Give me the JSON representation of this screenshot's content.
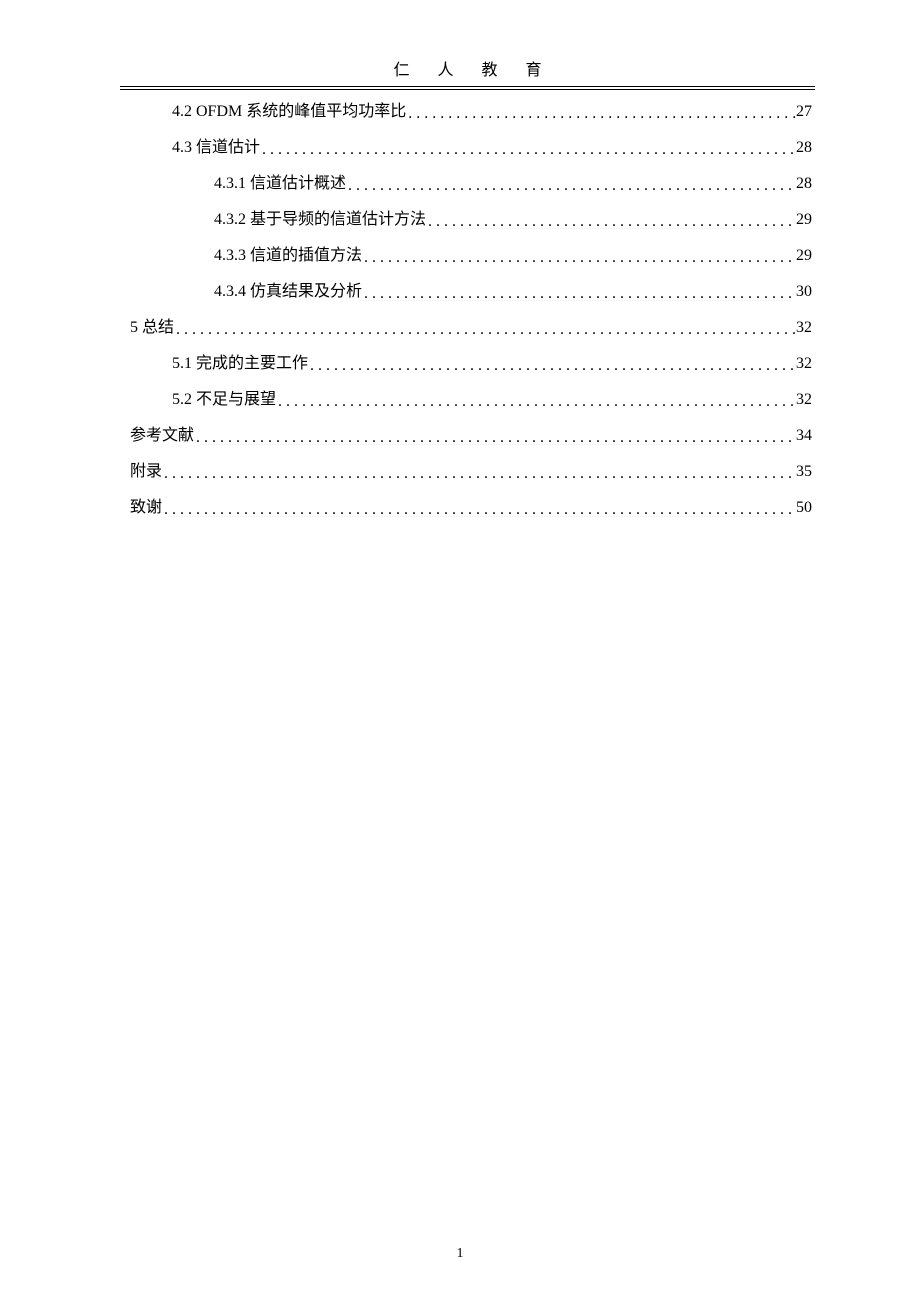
{
  "header": {
    "title": "仁 人 教 育"
  },
  "toc": [
    {
      "indent": 1,
      "label": "4.2 OFDM 系统的峰值平均功率比",
      "page": "27"
    },
    {
      "indent": 1,
      "label": "4.3 信道估计",
      "page": "28"
    },
    {
      "indent": 2,
      "label": "4.3.1 信道估计概述",
      "page": "28"
    },
    {
      "indent": 2,
      "label": "4.3.2 基于导频的信道估计方法",
      "page": "29"
    },
    {
      "indent": 2,
      "label": "4.3.3 信道的插值方法",
      "page": "29"
    },
    {
      "indent": 2,
      "label": "4.3.4 仿真结果及分析",
      "page": "30"
    },
    {
      "indent": 0,
      "label": "5 总结",
      "page": "32"
    },
    {
      "indent": 1,
      "label": "5.1 完成的主要工作",
      "page": "32"
    },
    {
      "indent": 1,
      "label": "5.2 不足与展望",
      "page": "32"
    },
    {
      "indent": 0,
      "label": "参考文献",
      "page": "34"
    },
    {
      "indent": 0,
      "label": "附录",
      "page": "35"
    },
    {
      "indent": 0,
      "label": "致谢",
      "page": "50"
    }
  ],
  "footer": {
    "page_number": "1"
  }
}
